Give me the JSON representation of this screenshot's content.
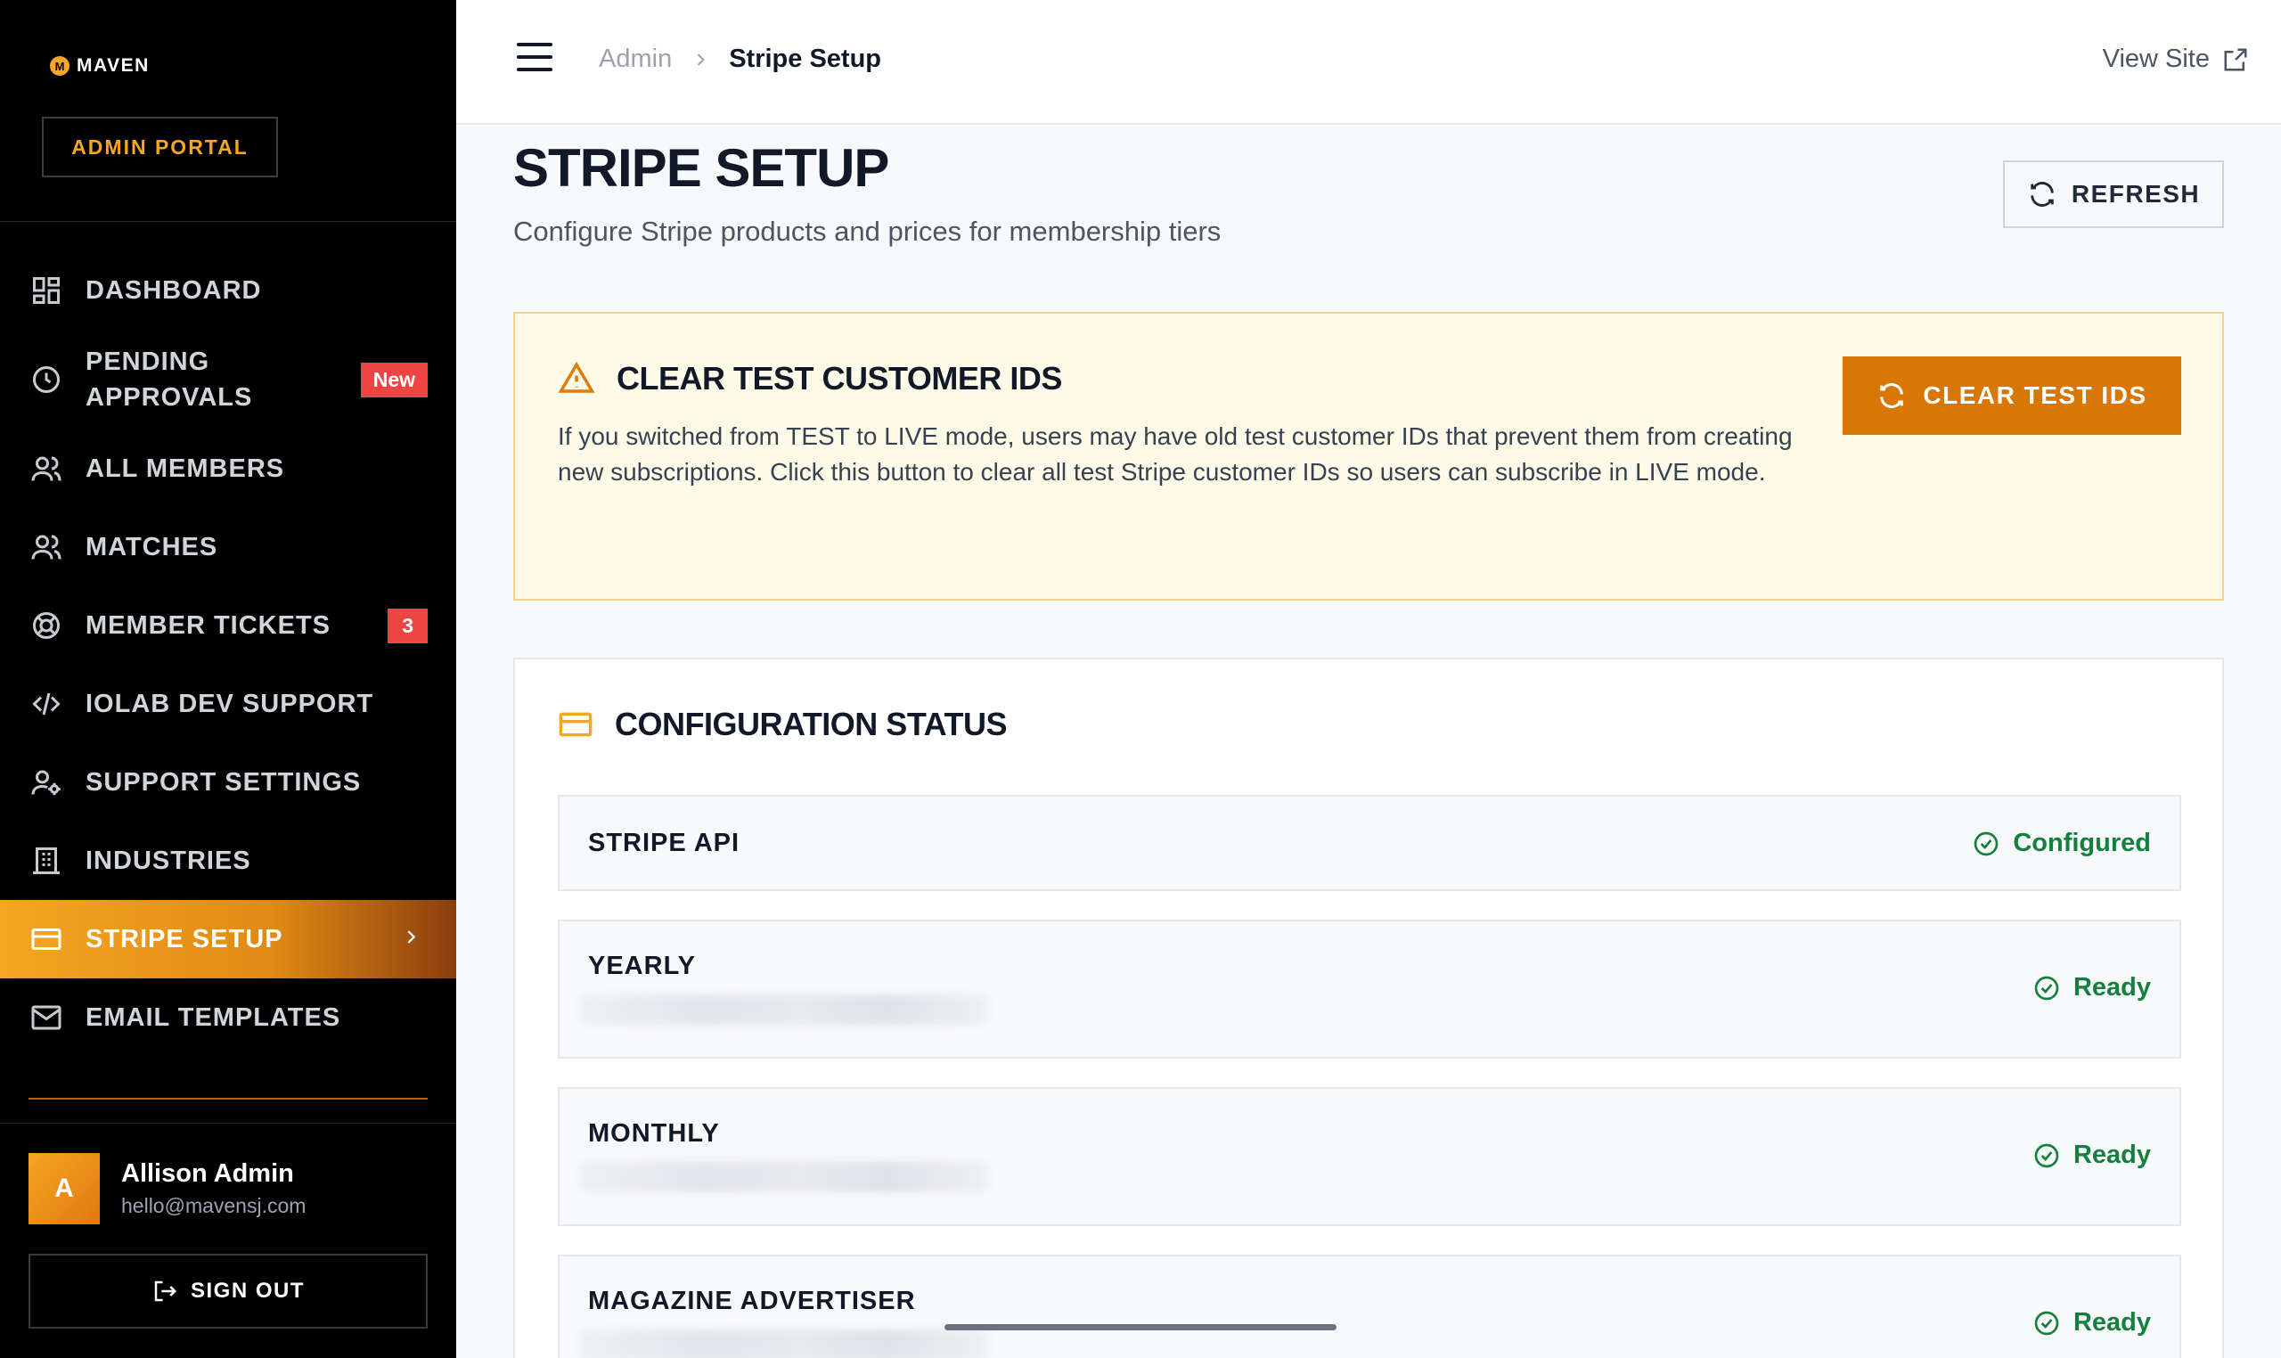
{
  "brand": {
    "logo_mark": "M",
    "name": "MAVEN",
    "portal_label": "ADMIN PORTAL"
  },
  "sidebar": {
    "items": [
      {
        "label": "DASHBOARD",
        "icon": "dashboard-icon"
      },
      {
        "label": "PENDING APPROVALS",
        "icon": "clock-icon",
        "badge": "New"
      },
      {
        "label": "ALL MEMBERS",
        "icon": "users-icon"
      },
      {
        "label": "MATCHES",
        "icon": "users-icon"
      },
      {
        "label": "MEMBER TICKETS",
        "icon": "lifebuoy-icon",
        "badge": "3"
      },
      {
        "label": "IOLAB DEV SUPPORT",
        "icon": "code-icon"
      },
      {
        "label": "SUPPORT SETTINGS",
        "icon": "user-cog-icon"
      },
      {
        "label": "INDUSTRIES",
        "icon": "building-icon"
      },
      {
        "label": "STRIPE SETUP",
        "icon": "credit-card-icon",
        "active": true
      },
      {
        "label": "EMAIL TEMPLATES",
        "icon": "mail-icon"
      }
    ],
    "user": {
      "initial": "A",
      "name": "Allison Admin",
      "email": "hello@mavensj.com"
    },
    "signout_label": "SIGN OUT"
  },
  "topbar": {
    "breadcrumb": {
      "parent": "Admin",
      "current": "Stripe Setup"
    },
    "view_site_label": "View Site"
  },
  "page": {
    "title": "STRIPE SETUP",
    "subtitle": "Configure Stripe products and prices for membership tiers",
    "refresh_label": "REFRESH"
  },
  "warning": {
    "title": "CLEAR TEST CUSTOMER IDS",
    "body": "If you switched from TEST to LIVE mode, users may have old test customer IDs that prevent them from creating new subscriptions. Click this button to clear all test Stripe customer IDs so users can subscribe in LIVE mode.",
    "button_label": "CLEAR TEST IDS"
  },
  "config": {
    "title": "CONFIGURATION STATUS",
    "rows": [
      {
        "label": "STRIPE API",
        "status": "Configured"
      },
      {
        "label": "YEARLY",
        "status": "Ready"
      },
      {
        "label": "MONTHLY",
        "status": "Ready"
      },
      {
        "label": "MAGAZINE ADVERTISER",
        "status": "Ready"
      }
    ]
  },
  "colors": {
    "accent": "#f5a623",
    "accent_dark": "#d97706",
    "success": "#15803d",
    "danger": "#ef4444"
  }
}
